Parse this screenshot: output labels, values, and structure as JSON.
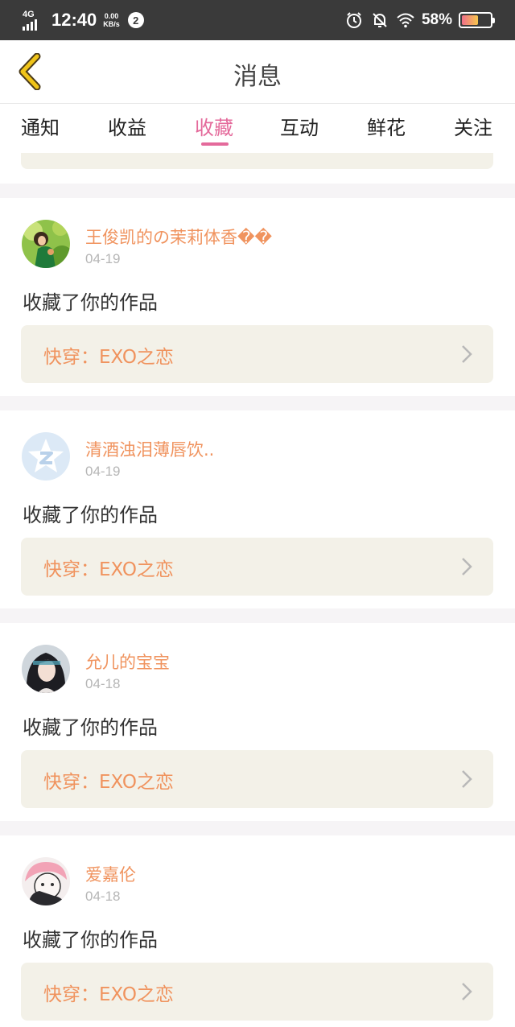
{
  "status_bar": {
    "network": "4G",
    "time": "12:40",
    "speed_value": "0.00",
    "speed_unit": "KB/s",
    "notification_count": "2",
    "battery_percent": "58%",
    "battery_level": 0.58
  },
  "header": {
    "title": "消息"
  },
  "tabs": [
    {
      "label": "通知"
    },
    {
      "label": "收益"
    },
    {
      "label": "收藏"
    },
    {
      "label": "互动"
    },
    {
      "label": "鲜花"
    },
    {
      "label": "关注"
    }
  ],
  "active_tab": "收藏",
  "messages": [
    {
      "username": "王俊凯的の茉莉体香��",
      "date": "04-19",
      "action": "收藏了你的作品",
      "work_title": "快穿：EXO之恋",
      "avatar": "photo-girl-green-dress"
    },
    {
      "username": "清酒浊泪薄唇饮..",
      "date": "04-19",
      "action": "收藏了你的作品",
      "work_title": "快穿：EXO之恋",
      "avatar": "default-star-avatar"
    },
    {
      "username": "允儿的宝宝",
      "date": "04-18",
      "action": "收藏了你的作品",
      "work_title": "快穿：EXO之恋",
      "avatar": "photo-girl-dark-hair"
    },
    {
      "username": "爱嘉伦",
      "date": "04-18",
      "action": "收藏了你的作品",
      "work_title": "快穿：EXO之恋",
      "avatar": "anime-pink-hair"
    }
  ],
  "colors": {
    "accent_pink": "#e46a9b",
    "username_orange": "#f0935e",
    "card_bg": "#f3f1e8",
    "status_bar_bg": "#3a3a3a",
    "back_arrow_yellow": "#f0c419"
  }
}
